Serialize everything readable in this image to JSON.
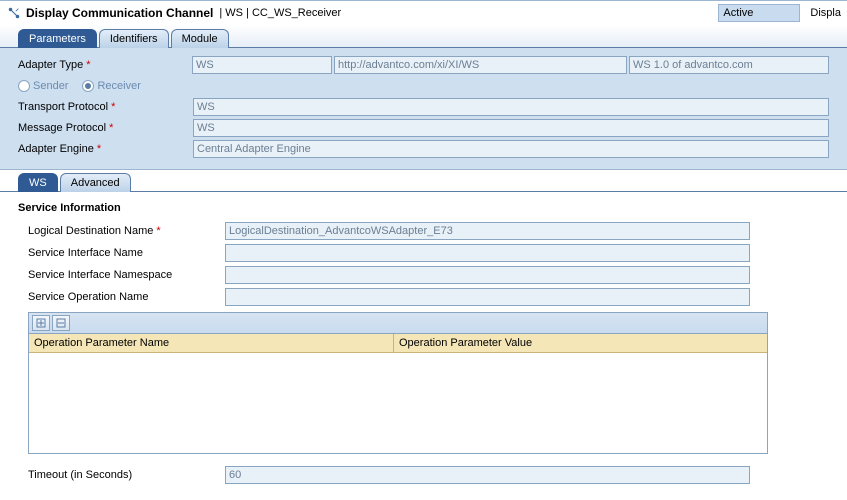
{
  "header": {
    "title": "Display Communication Channel",
    "breadcrumb": "| WS | CC_WS_Receiver",
    "status": "Active",
    "right_label": "Displa"
  },
  "main_tabs": {
    "parameters": "Parameters",
    "identifiers": "Identifiers",
    "module": "Module"
  },
  "form": {
    "adapter_type_label": "Adapter Type",
    "adapter_type_value": "WS",
    "adapter_namespace": "http://advantco.com/xi/XI/WS",
    "adapter_version": "WS 1.0 of advantco.com",
    "sender_label": "Sender",
    "receiver_label": "Receiver",
    "transport_label": "Transport Protocol",
    "transport_value": "WS",
    "message_label": "Message Protocol",
    "message_value": "WS",
    "engine_label": "Adapter Engine",
    "engine_value": "Central Adapter Engine"
  },
  "sub_tabs": {
    "ws": "WS",
    "advanced": "Advanced"
  },
  "service": {
    "section_title": "Service Information",
    "logical_dest_label": "Logical Destination Name",
    "logical_dest_value": "LogicalDestination_AdvantcoWSAdapter_E73",
    "iface_name_label": "Service Interface Name",
    "iface_name_value": "",
    "iface_ns_label": "Service Interface Namespace",
    "iface_ns_value": "",
    "op_name_label": "Service Operation Name",
    "op_name_value": "",
    "table": {
      "col1": "Operation Parameter Name",
      "col2": "Operation Parameter Value"
    },
    "timeout_label": "Timeout (in Seconds)",
    "timeout_value": "60"
  }
}
